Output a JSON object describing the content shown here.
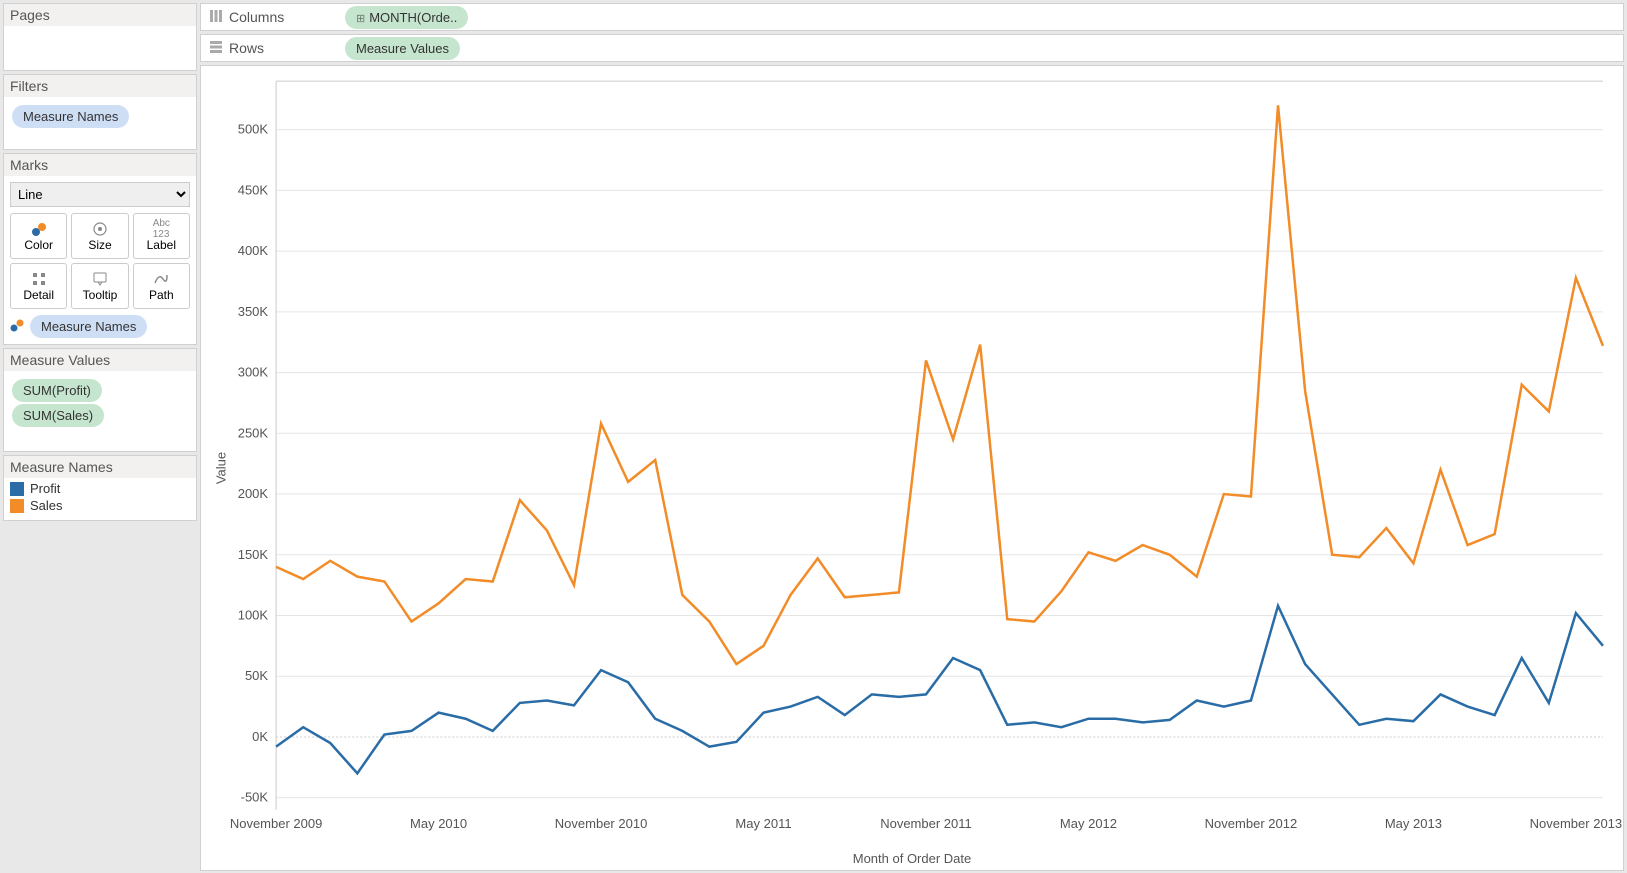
{
  "left": {
    "pages_header": "Pages",
    "filters_header": "Filters",
    "filters_pill": "Measure Names",
    "marks_header": "Marks",
    "marks_type": "Line",
    "mark_buttons": [
      "Color",
      "Size",
      "Label",
      "Detail",
      "Tooltip",
      "Path"
    ],
    "color_pill": "Measure Names",
    "mv_header": "Measure Values",
    "mv_pills": [
      "SUM(Profit)",
      "SUM(Sales)"
    ],
    "legend_header": "Measure Names",
    "legend_items": [
      {
        "label": "Profit",
        "color": "#2a6ca6"
      },
      {
        "label": "Sales",
        "color": "#f28c28"
      }
    ]
  },
  "shelves": {
    "columns_label": "Columns",
    "columns_pill": "MONTH(Orde..",
    "rows_label": "Rows",
    "rows_pill": "Measure Values"
  },
  "chart": {
    "y_title": "Value",
    "x_title": "Month of Order Date",
    "y_ticks": [
      -50000,
      0,
      50000,
      100000,
      150000,
      200000,
      250000,
      300000,
      350000,
      400000,
      450000,
      500000
    ],
    "y_tick_labels": [
      "-50K",
      "0K",
      "50K",
      "100K",
      "150K",
      "200K",
      "250K",
      "300K",
      "350K",
      "400K",
      "450K",
      "500K"
    ],
    "y_min": -60000,
    "y_max": 540000,
    "x_tick_labels": [
      "November 2009",
      "May 2010",
      "November 2010",
      "May 2011",
      "November 2011",
      "May 2012",
      "November 2012",
      "May 2013",
      "November 2013"
    ]
  },
  "chart_data": {
    "type": "line",
    "title": "",
    "xlabel": "Month of Order Date",
    "ylabel": "Value",
    "ylim": [
      -60000,
      540000
    ],
    "categories": [
      "Nov 2009",
      "Dec 2009",
      "Jan 2010",
      "Feb 2010",
      "Mar 2010",
      "Apr 2010",
      "May 2010",
      "Jun 2010",
      "Jul 2010",
      "Aug 2010",
      "Sep 2010",
      "Oct 2010",
      "Nov 2010",
      "Dec 2010",
      "Jan 2011",
      "Feb 2011",
      "Mar 2011",
      "Apr 2011",
      "May 2011",
      "Jun 2011",
      "Jul 2011",
      "Aug 2011",
      "Sep 2011",
      "Oct 2011",
      "Nov 2011",
      "Dec 2011",
      "Jan 2012",
      "Feb 2012",
      "Mar 2012",
      "Apr 2012",
      "May 2012",
      "Jun 2012",
      "Jul 2012",
      "Aug 2012",
      "Sep 2012",
      "Oct 2012",
      "Nov 2012",
      "Dec 2012",
      "Jan 2013",
      "Feb 2013",
      "Mar 2013",
      "Apr 2013",
      "May 2013",
      "Jun 2013",
      "Jul 2013",
      "Aug 2013",
      "Sep 2013",
      "Oct 2013",
      "Nov 2013",
      "Dec 2013"
    ],
    "x_tick_labels": [
      "November 2009",
      "May 2010",
      "November 2010",
      "May 2011",
      "November 2011",
      "May 2012",
      "November 2012",
      "May 2013",
      "November 2013"
    ],
    "series": [
      {
        "name": "Profit",
        "color": "#2a6ca6",
        "values": [
          -8000,
          8000,
          -5000,
          -30000,
          2000,
          5000,
          20000,
          15000,
          5000,
          28000,
          30000,
          26000,
          55000,
          45000,
          15000,
          5000,
          -8000,
          -4000,
          20000,
          25000,
          33000,
          18000,
          35000,
          33000,
          35000,
          65000,
          55000,
          10000,
          12000,
          8000,
          15000,
          15000,
          12000,
          14000,
          30000,
          25000,
          30000,
          108000,
          60000,
          35000,
          10000,
          15000,
          13000,
          35000,
          25000,
          18000,
          65000,
          28000,
          102000,
          75000
        ]
      },
      {
        "name": "Sales",
        "color": "#f28c28",
        "values": [
          140000,
          130000,
          145000,
          132000,
          128000,
          95000,
          110000,
          130000,
          128000,
          195000,
          170000,
          125000,
          258000,
          210000,
          228000,
          117000,
          95000,
          60000,
          75000,
          117000,
          147000,
          115000,
          117000,
          119000,
          310000,
          245000,
          323000,
          97000,
          95000,
          120000,
          152000,
          145000,
          158000,
          150000,
          132000,
          200000,
          198000,
          520000,
          285000,
          150000,
          148000,
          172000,
          143000,
          220000,
          158000,
          167000,
          290000,
          268000,
          378000,
          322000
        ]
      }
    ]
  }
}
